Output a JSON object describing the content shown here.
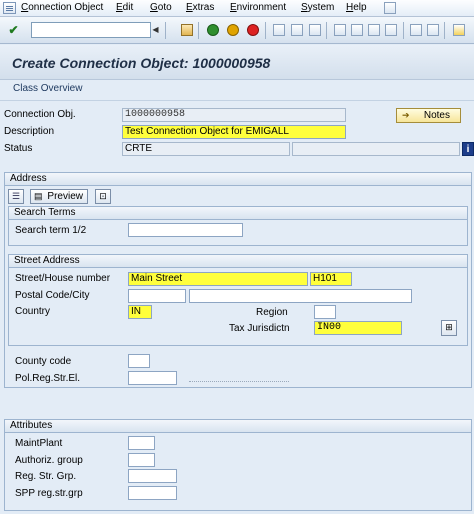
{
  "menu": {
    "items": [
      "Connection Object",
      "Edit",
      "Goto",
      "Extras",
      "Environment",
      "System",
      "Help"
    ]
  },
  "toolbar": {
    "command_value": "",
    "icons": [
      "enter-icon",
      "back-icon",
      "exit-icon",
      "cancel-icon",
      "print-icon",
      "find-icon",
      "find-next-icon",
      "first-page-icon",
      "prev-page-icon",
      "next-page-icon",
      "last-page-icon",
      "new-session-icon",
      "shortcut-icon",
      "help-icon",
      "layout-icon"
    ]
  },
  "title": "Create Connection Object: 1000000958",
  "app_toolbar": {
    "class_overview": "Class Overview"
  },
  "header": {
    "conn_obj_label": "Connection Obj.",
    "conn_obj_value": "1000000958",
    "description_label": "Description",
    "description_value": "Test Connection Object for EMIGALL",
    "status_label": "Status",
    "status_value": "CRTE",
    "notes_label": "Notes"
  },
  "address": {
    "title": "Address",
    "preview_label": "Preview",
    "search_terms": {
      "title": "Search Terms",
      "search_term_label": "Search term 1/2",
      "search_term_1": "",
      "search_term_2": ""
    },
    "street_address": {
      "title": "Street Address",
      "street_label": "Street/House number",
      "street_value": "Main Street",
      "house_value": "H101",
      "postal_label": "Postal Code/City",
      "postal_value": "",
      "city_value": "",
      "country_label": "Country",
      "country_value": "IN",
      "region_label": "Region",
      "region_value": "",
      "tax_label": "Tax Jurisdictn",
      "tax_value": "IN00"
    },
    "county_code_label": "County code",
    "county_code_value": "",
    "pol_reg_label": "Pol.Reg.Str.El.",
    "pol_reg_value": ""
  },
  "attributes": {
    "title": "Attributes",
    "maint_plant_label": "MaintPlant",
    "maint_plant_value": "",
    "auth_group_label": "Authoriz. group",
    "auth_group_value": "",
    "reg_str_grp_label": "Reg. Str. Grp.",
    "reg_str_grp_value": "",
    "spp_reg_label": "SPP reg.str.grp",
    "spp_reg_value": ""
  },
  "colors": {
    "highlight": "#ffff3c",
    "background": "#e3ecf6",
    "title_text": "#1f2f46"
  }
}
